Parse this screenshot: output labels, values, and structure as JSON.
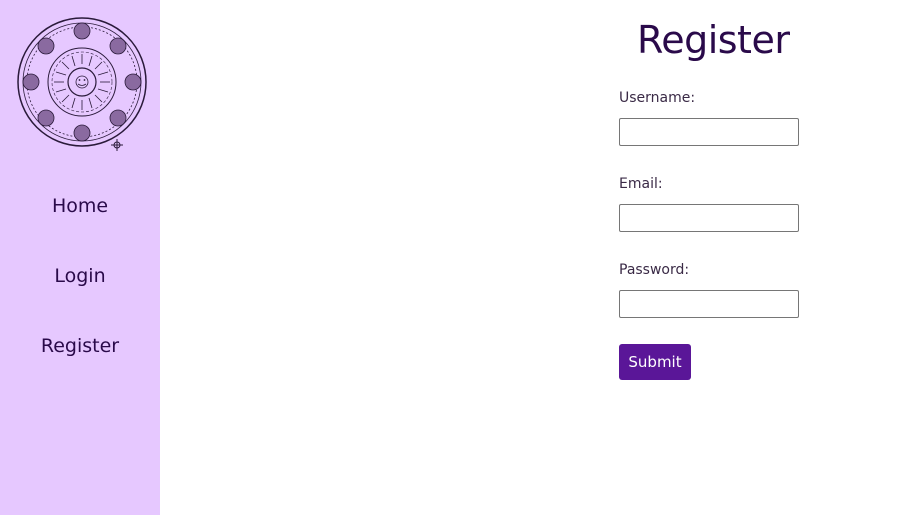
{
  "sidebar": {
    "logo_icon": "zodiac-sun-wheel-icon",
    "items": [
      {
        "label": "Home"
      },
      {
        "label": "Login"
      },
      {
        "label": "Register"
      }
    ]
  },
  "form": {
    "title": "Register",
    "fields": [
      {
        "label": "Username:",
        "value": ""
      },
      {
        "label": "Email:",
        "value": ""
      },
      {
        "label": "Password:",
        "value": ""
      }
    ],
    "submit_label": "Submit"
  },
  "colors": {
    "sidebar_bg": "#e6c8ff",
    "accent": "#5a1698",
    "title_text": "#2a0a4a"
  }
}
